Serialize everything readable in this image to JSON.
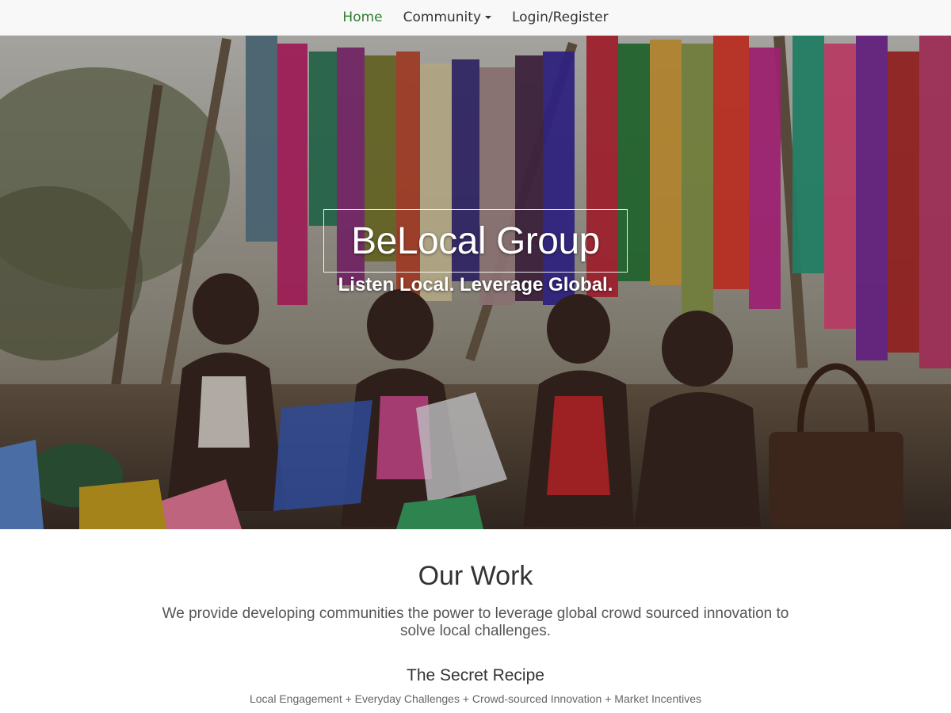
{
  "nav": {
    "items": [
      {
        "label": "Home",
        "active": true
      },
      {
        "label": "Community",
        "dropdown": true
      },
      {
        "label": "Login/Register"
      }
    ],
    "active_color": "#2e7d32"
  },
  "hero": {
    "title": "BeLocal Group",
    "tagline": "Listen Local. Leverage Global.",
    "image_description_icon": "market-photo"
  },
  "work": {
    "title": "Our Work",
    "description": "We provide developing communities the power to leverage global crowd sourced innovation to solve local challenges.",
    "recipe_title": "The Secret Recipe",
    "recipe_items": "Local Engagement + Everyday Challenges + Crowd-sourced Innovation + Market Incentives"
  }
}
